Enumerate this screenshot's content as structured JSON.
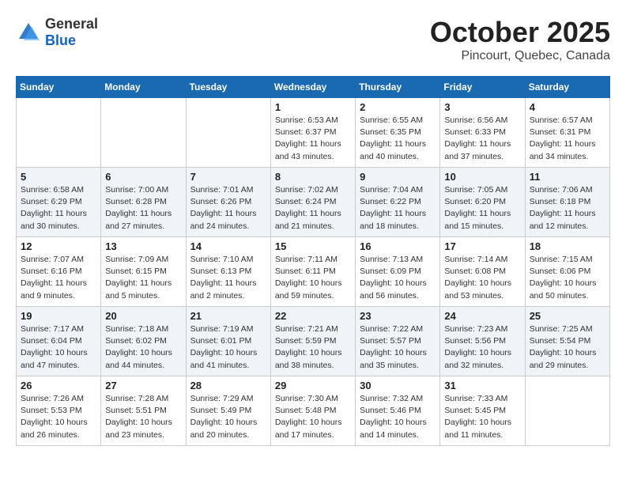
{
  "header": {
    "logo": {
      "general": "General",
      "blue": "Blue"
    },
    "title": "October 2025",
    "subtitle": "Pincourt, Quebec, Canada"
  },
  "weekdays": [
    "Sunday",
    "Monday",
    "Tuesday",
    "Wednesday",
    "Thursday",
    "Friday",
    "Saturday"
  ],
  "weeks": [
    [
      {
        "day": "",
        "info": ""
      },
      {
        "day": "",
        "info": ""
      },
      {
        "day": "",
        "info": ""
      },
      {
        "day": "1",
        "info": "Sunrise: 6:53 AM\nSunset: 6:37 PM\nDaylight: 11 hours\nand 43 minutes."
      },
      {
        "day": "2",
        "info": "Sunrise: 6:55 AM\nSunset: 6:35 PM\nDaylight: 11 hours\nand 40 minutes."
      },
      {
        "day": "3",
        "info": "Sunrise: 6:56 AM\nSunset: 6:33 PM\nDaylight: 11 hours\nand 37 minutes."
      },
      {
        "day": "4",
        "info": "Sunrise: 6:57 AM\nSunset: 6:31 PM\nDaylight: 11 hours\nand 34 minutes."
      }
    ],
    [
      {
        "day": "5",
        "info": "Sunrise: 6:58 AM\nSunset: 6:29 PM\nDaylight: 11 hours\nand 30 minutes."
      },
      {
        "day": "6",
        "info": "Sunrise: 7:00 AM\nSunset: 6:28 PM\nDaylight: 11 hours\nand 27 minutes."
      },
      {
        "day": "7",
        "info": "Sunrise: 7:01 AM\nSunset: 6:26 PM\nDaylight: 11 hours\nand 24 minutes."
      },
      {
        "day": "8",
        "info": "Sunrise: 7:02 AM\nSunset: 6:24 PM\nDaylight: 11 hours\nand 21 minutes."
      },
      {
        "day": "9",
        "info": "Sunrise: 7:04 AM\nSunset: 6:22 PM\nDaylight: 11 hours\nand 18 minutes."
      },
      {
        "day": "10",
        "info": "Sunrise: 7:05 AM\nSunset: 6:20 PM\nDaylight: 11 hours\nand 15 minutes."
      },
      {
        "day": "11",
        "info": "Sunrise: 7:06 AM\nSunset: 6:18 PM\nDaylight: 11 hours\nand 12 minutes."
      }
    ],
    [
      {
        "day": "12",
        "info": "Sunrise: 7:07 AM\nSunset: 6:16 PM\nDaylight: 11 hours\nand 9 minutes."
      },
      {
        "day": "13",
        "info": "Sunrise: 7:09 AM\nSunset: 6:15 PM\nDaylight: 11 hours\nand 5 minutes."
      },
      {
        "day": "14",
        "info": "Sunrise: 7:10 AM\nSunset: 6:13 PM\nDaylight: 11 hours\nand 2 minutes."
      },
      {
        "day": "15",
        "info": "Sunrise: 7:11 AM\nSunset: 6:11 PM\nDaylight: 10 hours\nand 59 minutes."
      },
      {
        "day": "16",
        "info": "Sunrise: 7:13 AM\nSunset: 6:09 PM\nDaylight: 10 hours\nand 56 minutes."
      },
      {
        "day": "17",
        "info": "Sunrise: 7:14 AM\nSunset: 6:08 PM\nDaylight: 10 hours\nand 53 minutes."
      },
      {
        "day": "18",
        "info": "Sunrise: 7:15 AM\nSunset: 6:06 PM\nDaylight: 10 hours\nand 50 minutes."
      }
    ],
    [
      {
        "day": "19",
        "info": "Sunrise: 7:17 AM\nSunset: 6:04 PM\nDaylight: 10 hours\nand 47 minutes."
      },
      {
        "day": "20",
        "info": "Sunrise: 7:18 AM\nSunset: 6:02 PM\nDaylight: 10 hours\nand 44 minutes."
      },
      {
        "day": "21",
        "info": "Sunrise: 7:19 AM\nSunset: 6:01 PM\nDaylight: 10 hours\nand 41 minutes."
      },
      {
        "day": "22",
        "info": "Sunrise: 7:21 AM\nSunset: 5:59 PM\nDaylight: 10 hours\nand 38 minutes."
      },
      {
        "day": "23",
        "info": "Sunrise: 7:22 AM\nSunset: 5:57 PM\nDaylight: 10 hours\nand 35 minutes."
      },
      {
        "day": "24",
        "info": "Sunrise: 7:23 AM\nSunset: 5:56 PM\nDaylight: 10 hours\nand 32 minutes."
      },
      {
        "day": "25",
        "info": "Sunrise: 7:25 AM\nSunset: 5:54 PM\nDaylight: 10 hours\nand 29 minutes."
      }
    ],
    [
      {
        "day": "26",
        "info": "Sunrise: 7:26 AM\nSunset: 5:53 PM\nDaylight: 10 hours\nand 26 minutes."
      },
      {
        "day": "27",
        "info": "Sunrise: 7:28 AM\nSunset: 5:51 PM\nDaylight: 10 hours\nand 23 minutes."
      },
      {
        "day": "28",
        "info": "Sunrise: 7:29 AM\nSunset: 5:49 PM\nDaylight: 10 hours\nand 20 minutes."
      },
      {
        "day": "29",
        "info": "Sunrise: 7:30 AM\nSunset: 5:48 PM\nDaylight: 10 hours\nand 17 minutes."
      },
      {
        "day": "30",
        "info": "Sunrise: 7:32 AM\nSunset: 5:46 PM\nDaylight: 10 hours\nand 14 minutes."
      },
      {
        "day": "31",
        "info": "Sunrise: 7:33 AM\nSunset: 5:45 PM\nDaylight: 10 hours\nand 11 minutes."
      },
      {
        "day": "",
        "info": ""
      }
    ]
  ]
}
